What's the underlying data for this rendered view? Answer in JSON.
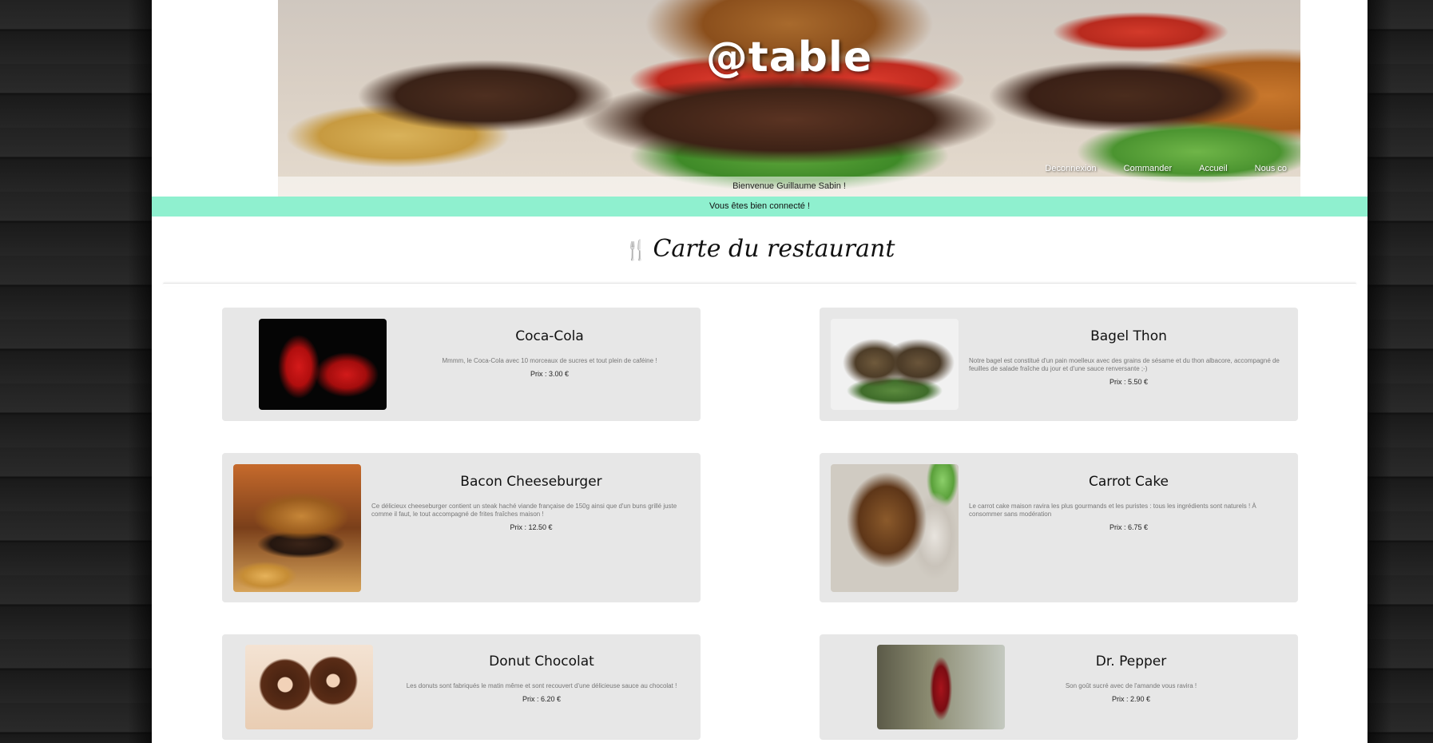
{
  "header": {
    "logo_text": "@table",
    "nav": [
      "Deconnexion",
      "Commander",
      "Accueil",
      "Nous co"
    ],
    "welcome": "Bienvenue Guillaume Sabin !"
  },
  "alert": {
    "message": "Vous êtes bien connecté !"
  },
  "menu": {
    "title": "Carte du restaurant",
    "title_icon": "fork-knife-icon",
    "items": [
      {
        "name": "Coca-Cola",
        "description": "Mmmm, le Coca-Cola avec 10 morceaux de sucres et tout plein de caféine !",
        "price": "Prix : 3.00 €",
        "image": "coca-cola-can-image"
      },
      {
        "name": "Bagel Thon",
        "description": "Notre bagel est constitué d'un pain moelleux avec des grains de sésame et du thon albacore, accompagné de feuilles de salade fraîche du jour et d'une sauce renversante ;-)",
        "price": "Prix : 5.50 €",
        "image": "bagel-image"
      },
      {
        "name": "Bacon Cheeseburger",
        "description": "Ce délicieux cheeseburger contient un steak haché viande française de 150g ainsi que d'un buns grillé juste comme il faut, le tout accompagné de frites fraîches maison !",
        "price": "Prix : 12.50 €",
        "image": "burger-image"
      },
      {
        "name": "Carrot Cake",
        "description": "Le carrot cake maison ravira les plus gourmands et les puristes : tous les ingrédients sont naturels ! À consommer sans modération",
        "price": "Prix : 6.75 €",
        "image": "carrot-cake-image"
      },
      {
        "name": "Donut Chocolat",
        "description": "Les donuts sont fabriqués le matin même et sont recouvert d'une délicieuse sauce au chocolat !",
        "price": "Prix : 6.20 €",
        "image": "donut-image"
      },
      {
        "name": "Dr. Pepper",
        "description": "Son goût sucré avec de l'amande vous ravira !",
        "price": "Prix : 2.90 €",
        "image": "dr-pepper-can-image"
      }
    ]
  }
}
